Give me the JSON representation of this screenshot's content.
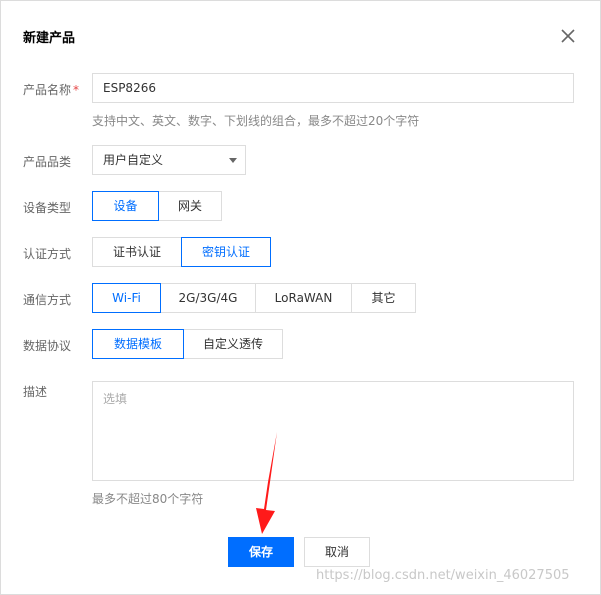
{
  "dialog": {
    "title": "新建产品"
  },
  "form": {
    "name": {
      "label": "产品名称",
      "required_mark": "*",
      "value": "ESP8266",
      "hint": "支持中文、英文、数字、下划线的组合，最多不超过20个字符"
    },
    "category": {
      "label": "产品品类",
      "value": "用户自定义"
    },
    "device_type": {
      "label": "设备类型",
      "options": [
        "设备",
        "网关"
      ],
      "selected": "设备"
    },
    "auth": {
      "label": "认证方式",
      "options": [
        "证书认证",
        "密钥认证"
      ],
      "selected": "密钥认证"
    },
    "comm": {
      "label": "通信方式",
      "options": [
        "Wi-Fi",
        "2G/3G/4G",
        "LoRaWAN",
        "其它"
      ],
      "selected": "Wi-Fi"
    },
    "protocol": {
      "label": "数据协议",
      "options": [
        "数据模板",
        "自定义透传"
      ],
      "selected": "数据模板"
    },
    "desc": {
      "label": "描述",
      "placeholder": "选填",
      "hint": "最多不超过80个字符"
    }
  },
  "buttons": {
    "save": "保存",
    "cancel": "取消"
  },
  "watermark": "https://blog.csdn.net/weixin_46027505",
  "colors": {
    "accent": "#006eff",
    "annotation_arrow": "#ff1a1a",
    "required": "#e54545"
  },
  "icons": {
    "close": "close-icon",
    "dropdown": "chevron-down-icon"
  }
}
